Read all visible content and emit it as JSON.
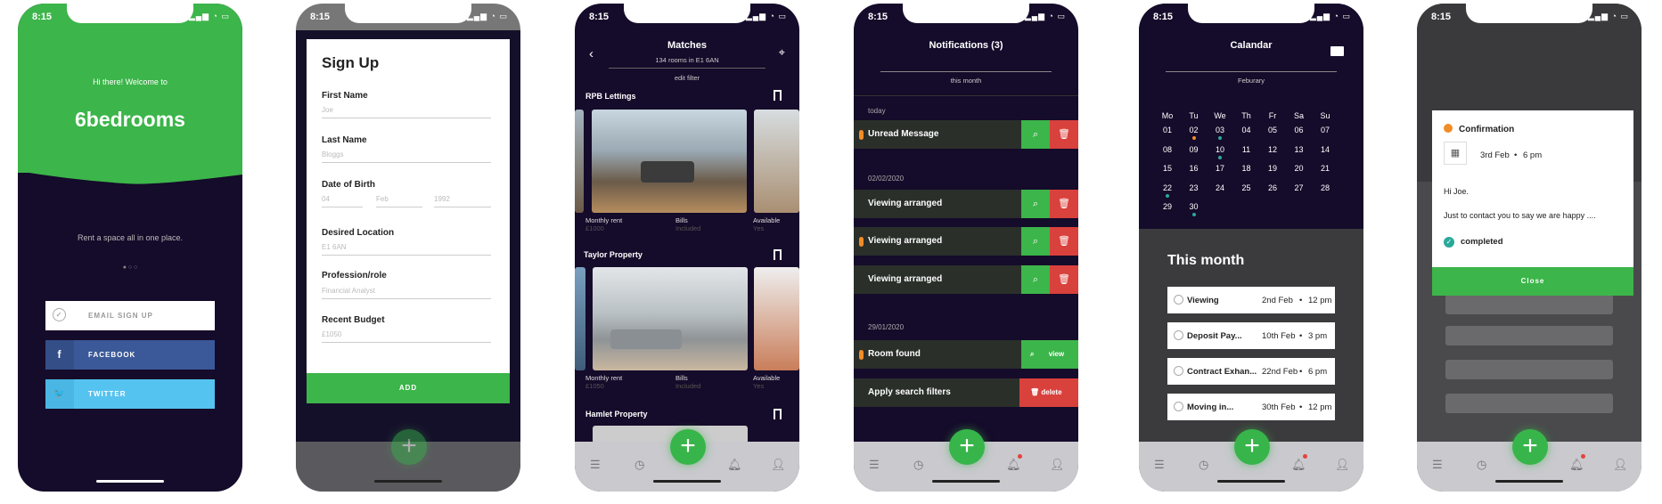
{
  "status": {
    "time": "8:15"
  },
  "welcome": {
    "greeting": "Hi there! Welcome to",
    "brand": "6bedrooms",
    "tagline": "Rent a space all in one place.",
    "buttons": {
      "email": "EMAIL SIGN UP",
      "facebook": "FACEBOOK",
      "twitter": "TWITTER"
    },
    "colors": {
      "green": "#3cb54a",
      "facebook": "#3b5998",
      "twitter": "#55c3f0"
    }
  },
  "signup": {
    "title": "Sign Up",
    "fields": [
      {
        "label": "First Name",
        "value": "Joe"
      },
      {
        "label": "Last Name",
        "value": "Bloggs"
      },
      {
        "label": "Date of Birth",
        "day": "04",
        "month": "Feb",
        "year": "1992"
      },
      {
        "label": "Desired Location",
        "value": "E1 6AN"
      },
      {
        "label": "Profession/role",
        "value": "Financial Analyst"
      },
      {
        "label": "Recent Budget",
        "value": "£1050"
      }
    ],
    "add": "ADD"
  },
  "matches": {
    "title": "Matches",
    "subtitle": "134 rooms in E1 6AN",
    "edit": "edit filter",
    "sections": [
      {
        "name": "RPB Lettings",
        "rent_label": "Monthly rent",
        "rent": "£1000",
        "bills_label": "Bills",
        "bills": "Included",
        "avail_label": "Available",
        "avail": "Yes"
      },
      {
        "name": "Taylor Property",
        "rent_label": "Monthly rent",
        "rent": "£1050",
        "bills_label": "Bills",
        "bills": "Included",
        "avail_label": "Available",
        "avail": "Yes"
      },
      {
        "name": "Hamlet Property"
      }
    ]
  },
  "notifications": {
    "title": "Notifications (3)",
    "filter": "this month",
    "groups": [
      {
        "date": "today",
        "items": [
          "Unread Message"
        ]
      },
      {
        "date": "02/02/2020",
        "items": [
          "Viewing arranged",
          "Viewing arranged",
          "Viewing arranged"
        ]
      },
      {
        "date": "29/01/2020",
        "items": [
          "Room found",
          "Apply search filters"
        ]
      }
    ],
    "view": "view",
    "delete": "delete"
  },
  "calendar": {
    "title": "Calandar",
    "month": "Feburary",
    "days": [
      "Mo",
      "Tu",
      "We",
      "Th",
      "Fr",
      "Sa",
      "Su"
    ],
    "dates": [
      [
        "01",
        "02",
        "03",
        "04",
        "05",
        "06",
        "07"
      ],
      [
        "08",
        "09",
        "10",
        "11",
        "12",
        "13",
        "14"
      ],
      [
        "15",
        "16",
        "17",
        "18",
        "19",
        "20",
        "21"
      ],
      [
        "22",
        "23",
        "24",
        "25",
        "26",
        "27",
        "28"
      ],
      [
        "29",
        "30",
        "",
        "",
        "",
        "",
        ""
      ]
    ],
    "this_month": "This month",
    "events": [
      {
        "name": "Viewing",
        "date": "2nd Feb",
        "time": "12 pm"
      },
      {
        "name": "Deposit Pay...",
        "date": "10th Feb",
        "time": "3 pm"
      },
      {
        "name": "Contract Exhan...",
        "date": "22nd Feb",
        "time": "6 pm"
      },
      {
        "name": "Moving in...",
        "date": "30th Feb",
        "time": "12 pm"
      }
    ],
    "sep": "•"
  },
  "confirm": {
    "title": "Confirmation",
    "when": "3rd Feb",
    "time": "6 pm",
    "greeting": "Hi Joe.",
    "message": "Just to contact you to say we are happy ....",
    "status": "completed",
    "close": "Close"
  }
}
